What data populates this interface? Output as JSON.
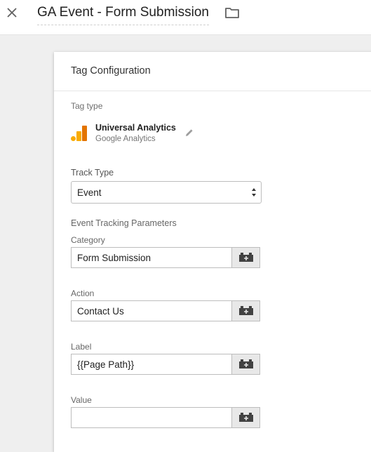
{
  "header": {
    "title": "GA Event - Form Submission",
    "close_icon": "close-icon",
    "folder_icon": "folder-icon"
  },
  "card": {
    "title": "Tag Configuration",
    "tag_type_label": "Tag type",
    "tag_name": "Universal Analytics",
    "tag_vendor": "Google Analytics",
    "tag_icon": "universal-analytics-icon",
    "edit_icon": "pencil-icon",
    "brand_colors": {
      "dark": "#e37400",
      "light": "#f9ab00"
    }
  },
  "track_type": {
    "label": "Track Type",
    "value": "Event"
  },
  "event_params": {
    "label": "Event Tracking Parameters",
    "fields": [
      {
        "label": "Category",
        "value": "Form Submission"
      },
      {
        "label": "Action",
        "value": "Contact Us"
      },
      {
        "label": "Label",
        "value": "{{Page Path}}"
      },
      {
        "label": "Value",
        "value": ""
      }
    ],
    "variable_icon": "variable-picker-icon"
  }
}
